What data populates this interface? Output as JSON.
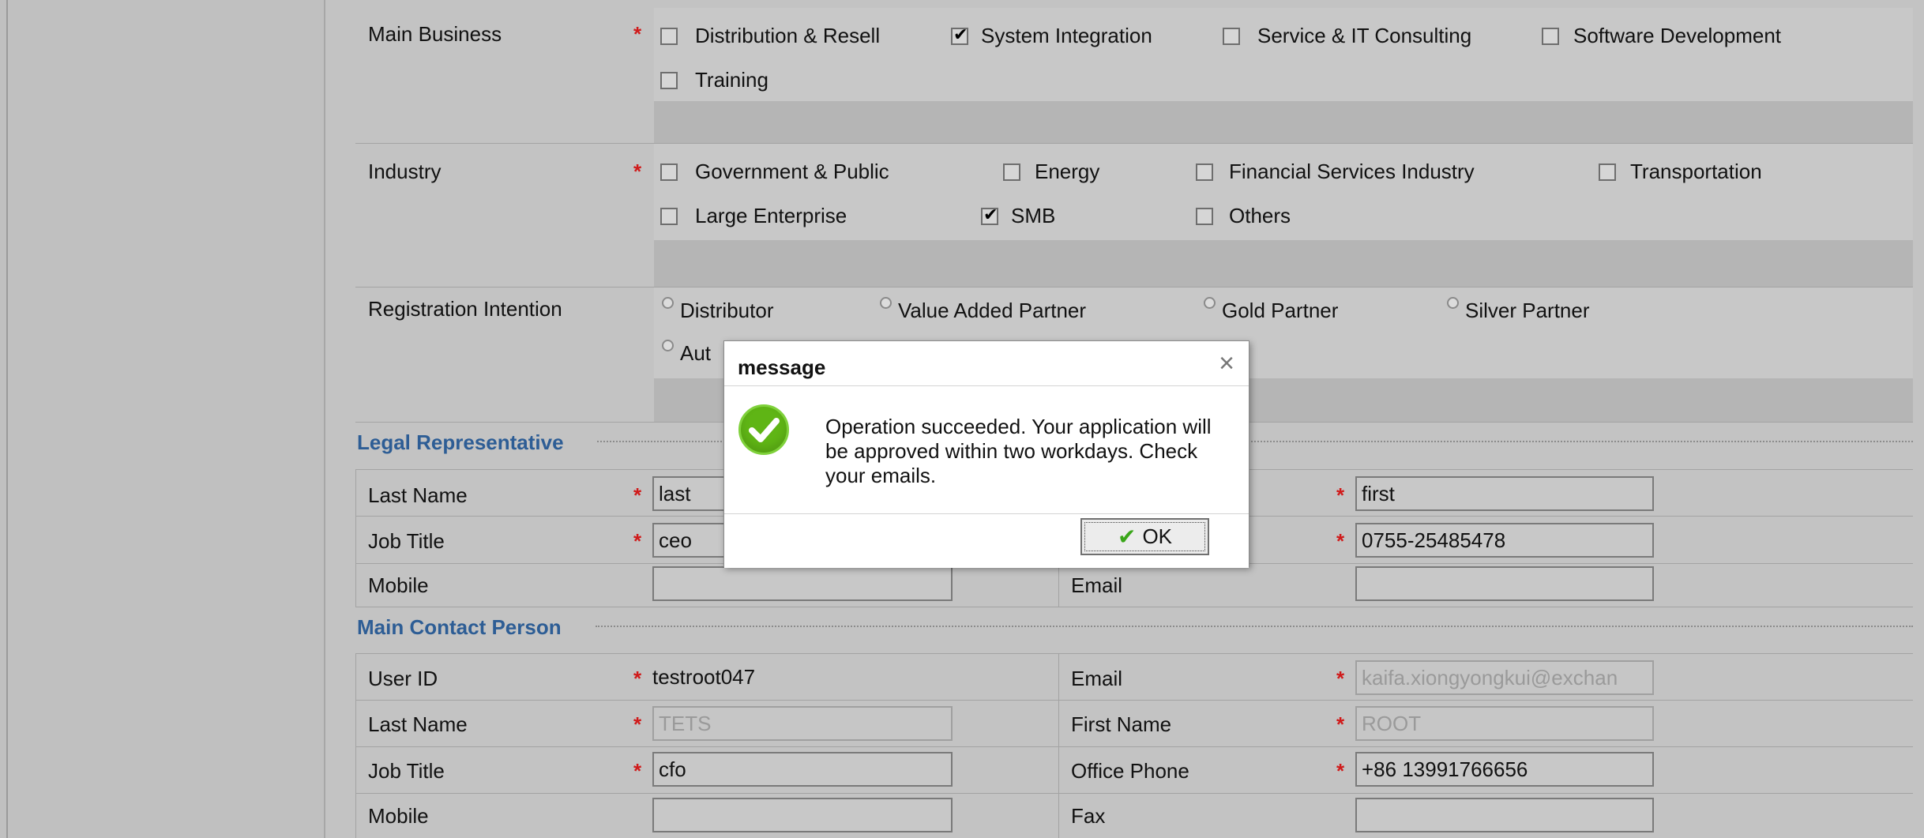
{
  "main_business": {
    "label": "Main Business",
    "required_mark": "*",
    "options": [
      {
        "label": "Distribution & Resell",
        "checked": false
      },
      {
        "label": "System Integration",
        "checked": true
      },
      {
        "label": "Service & IT Consulting",
        "checked": false
      },
      {
        "label": "Software Development",
        "checked": false
      },
      {
        "label": "Training",
        "checked": false
      }
    ]
  },
  "industry": {
    "label": "Industry",
    "required_mark": "*",
    "options": [
      {
        "label": "Government & Public",
        "checked": false
      },
      {
        "label": "Energy",
        "checked": false
      },
      {
        "label": "Financial Services Industry",
        "checked": false
      },
      {
        "label": "Transportation",
        "checked": false
      },
      {
        "label": "Large Enterprise",
        "checked": false
      },
      {
        "label": "SMB",
        "checked": true
      },
      {
        "label": "Others",
        "checked": false
      }
    ]
  },
  "registration_intention": {
    "label": "Registration Intention",
    "options": [
      {
        "label": "Distributor",
        "selected": false
      },
      {
        "label": "Value Added Partner",
        "selected": false
      },
      {
        "label": "Gold Partner",
        "selected": false
      },
      {
        "label": "Silver Partner",
        "selected": false
      },
      {
        "label": "Aut",
        "selected": false
      }
    ]
  },
  "legal_representative": {
    "title": "Legal Representative",
    "last_name_label": "Last Name",
    "last_name_value": "last",
    "first_name_value": "first",
    "job_title_label": "Job Title",
    "job_title_value": "ceo",
    "phone_value": "0755-25485478",
    "mobile_label": "Mobile",
    "mobile_value": "",
    "email_label": "Email",
    "email_value": ""
  },
  "main_contact": {
    "title": "Main Contact Person",
    "user_id_label": "User ID",
    "user_id_value": "testroot047",
    "email_label": "Email",
    "email_value": "kaifa.xiongyongkui@exchan",
    "last_name_label": "Last Name",
    "last_name_value": "TETS",
    "first_name_label": "First Name",
    "first_name_value": "ROOT",
    "job_title_label": "Job Title",
    "job_title_value": "cfo",
    "office_phone_label": "Office Phone",
    "office_phone_value": "+86 13991766656",
    "mobile_label": "Mobile",
    "mobile_value": "",
    "fax_label": "Fax",
    "fax_value": ""
  },
  "required_mark": "*",
  "dialog": {
    "title": "message",
    "close_glyph": "×",
    "message": "Operation succeeded. Your application will be approved within two workdays. Check your emails.",
    "ok_label": "OK",
    "icon": "success-check-icon"
  },
  "colors": {
    "section_title": "#2d5d95",
    "required": "#d01a1a",
    "success": "#5fb515"
  }
}
